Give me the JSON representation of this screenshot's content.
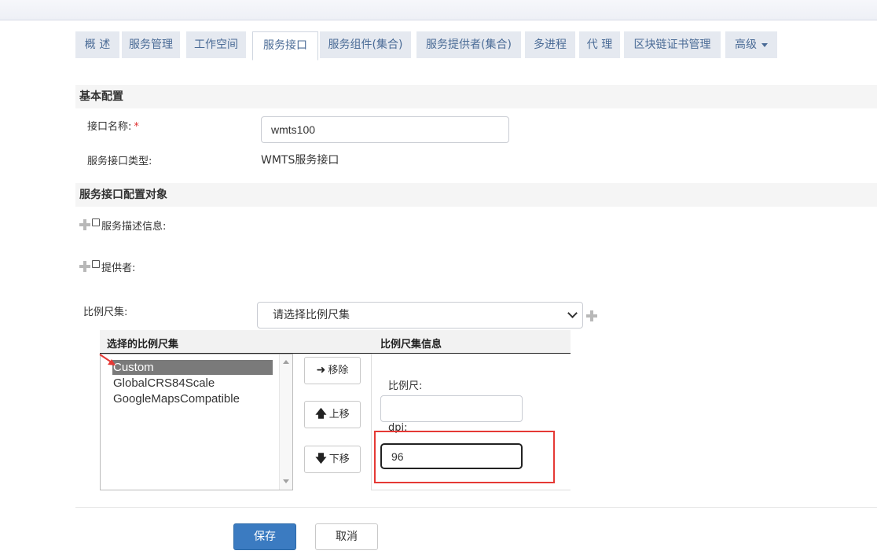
{
  "tabs": [
    {
      "label": "概 述"
    },
    {
      "label": "服务管理"
    },
    {
      "label": "工作空间"
    },
    {
      "label": "服务接口"
    },
    {
      "label": "服务组件(集合)"
    },
    {
      "label": "服务提供者(集合)"
    },
    {
      "label": "多进程"
    },
    {
      "label": "代 理"
    },
    {
      "label": "区块链证书管理"
    },
    {
      "label": "高级"
    }
  ],
  "active_tab": "服务接口",
  "basic": {
    "title": "基本配置",
    "name_label": "接口名称:",
    "required_mark": "*",
    "name_value": "wmts100",
    "type_label": "服务接口类型:",
    "type_value": "WMTS服务接口"
  },
  "config": {
    "title": "服务接口配置对象",
    "service_desc_label": "服务描述信息:",
    "provider_label": "提供者:",
    "scale_set_label": "比例尺集:",
    "scale_set_selected": "请选择比例尺集"
  },
  "scale_panel": {
    "selected_header": "选择的比例尺集",
    "info_header": "比例尺集信息",
    "items": [
      "Custom",
      "GlobalCRS84Scale",
      "GoogleMapsCompatible"
    ],
    "selected_item": "Custom",
    "remove_label": "移除",
    "move_up_label": "上移",
    "move_down_label": "下移",
    "scale_label": "比例尺:",
    "scale_value": "",
    "dpi_label": "dpi:",
    "dpi_value": "96"
  },
  "actions": {
    "save_label": "保存",
    "cancel_label": "取消"
  },
  "colors": {
    "tab_bg": "#e5e9f0",
    "tab_text": "#4a6b96",
    "primary": "#3b7bc1",
    "highlight_box": "#e53935",
    "selected_item_bg": "#7a7a7a"
  }
}
